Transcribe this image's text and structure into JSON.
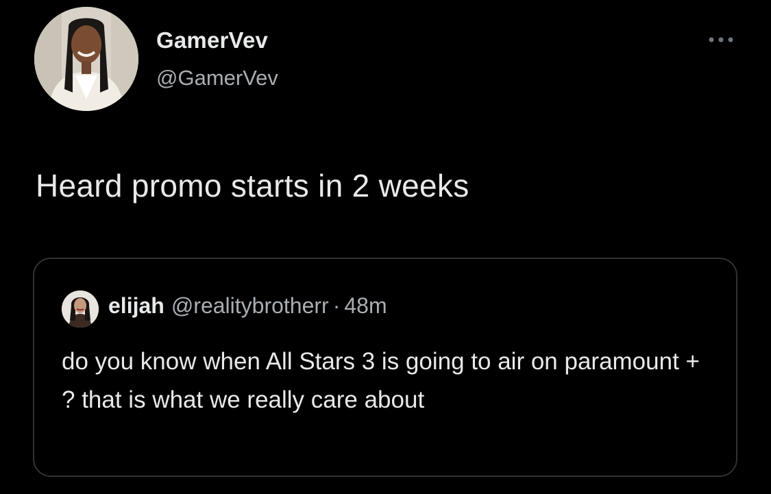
{
  "tweet": {
    "author": {
      "display_name": "GamerVev",
      "handle": "@GamerVev",
      "avatar_icon": "profile-photo-avatar"
    },
    "more_icon": "more-horizontal-icon",
    "text": "Heard promo starts in 2 weeks",
    "quoted_tweet": {
      "author": {
        "display_name": "elijah",
        "handle": "@realitybrotherr",
        "avatar_icon": "profile-photo-avatar"
      },
      "separator": "·",
      "time": "48m",
      "text": "do you know when All Stars 3 is going to air on paramount + ? that is what we really care about"
    }
  },
  "colors": {
    "background": "#000000",
    "primary_text": "#e7e9ea",
    "secondary_text": "#a9aeb2",
    "border": "#2f3336"
  }
}
